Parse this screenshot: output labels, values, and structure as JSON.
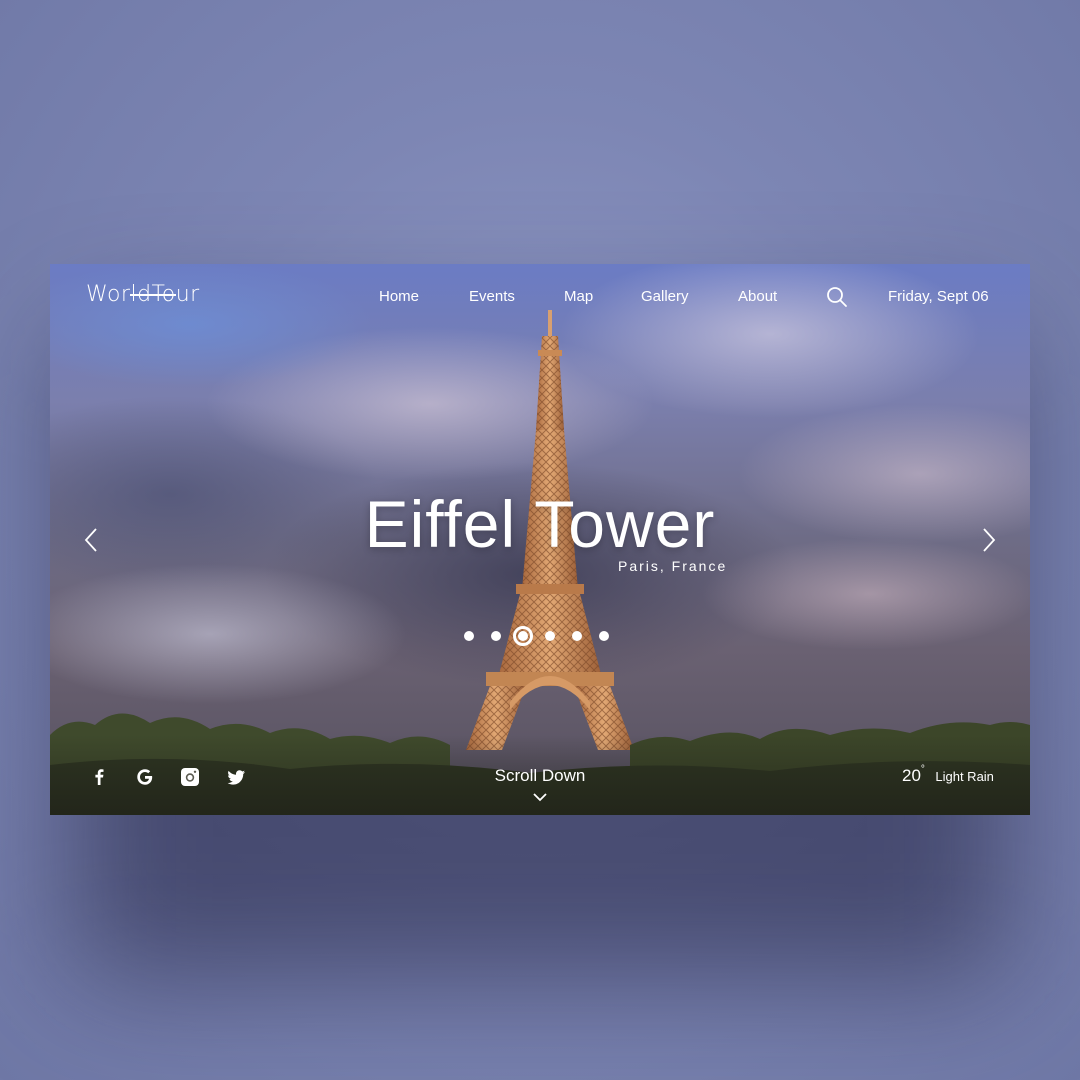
{
  "brand": {
    "logo_text": "WorldTour"
  },
  "nav": {
    "items": [
      "Home",
      "Events",
      "Map",
      "Gallery",
      "About"
    ],
    "date": "Friday, Sept 06"
  },
  "hero": {
    "title": "Eiffel Tower",
    "subtitle": "Paris, France",
    "slides": {
      "count": 6,
      "active": 3
    }
  },
  "social": {
    "icons": [
      "facebook-icon",
      "google-icon",
      "instagram-icon",
      "twitter-icon"
    ]
  },
  "scroll": {
    "label": "Scroll Down"
  },
  "weather": {
    "temp": "20",
    "unit": "°",
    "condition": "Light Rain"
  },
  "colors": {
    "overlay_text": "#ffffff",
    "page_background": "#7d86b4",
    "tower": "#c98a55"
  }
}
